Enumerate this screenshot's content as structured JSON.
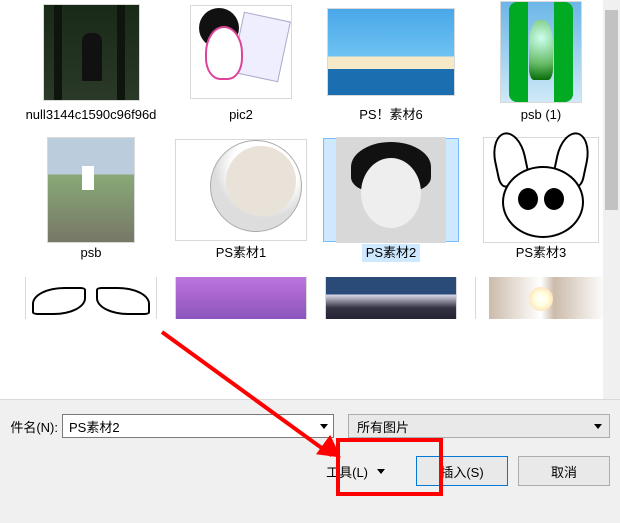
{
  "files": {
    "row1": [
      {
        "label": "null3144c1590c96f96d"
      },
      {
        "label": "pic2"
      },
      {
        "label": "PS！素材6"
      },
      {
        "label": "psb (1)"
      }
    ],
    "row2": [
      {
        "label": "psb"
      },
      {
        "label": "PS素材1"
      },
      {
        "label": "PS素材2",
        "selected": true
      },
      {
        "label": "PS素材3"
      }
    ]
  },
  "bottom": {
    "filename_label": "件名(N):",
    "filename_value": "PS素材2",
    "filter_label": "所有图片",
    "tools_label": "工具(L)",
    "insert_label": "插入(S)",
    "cancel_label": "取消"
  }
}
